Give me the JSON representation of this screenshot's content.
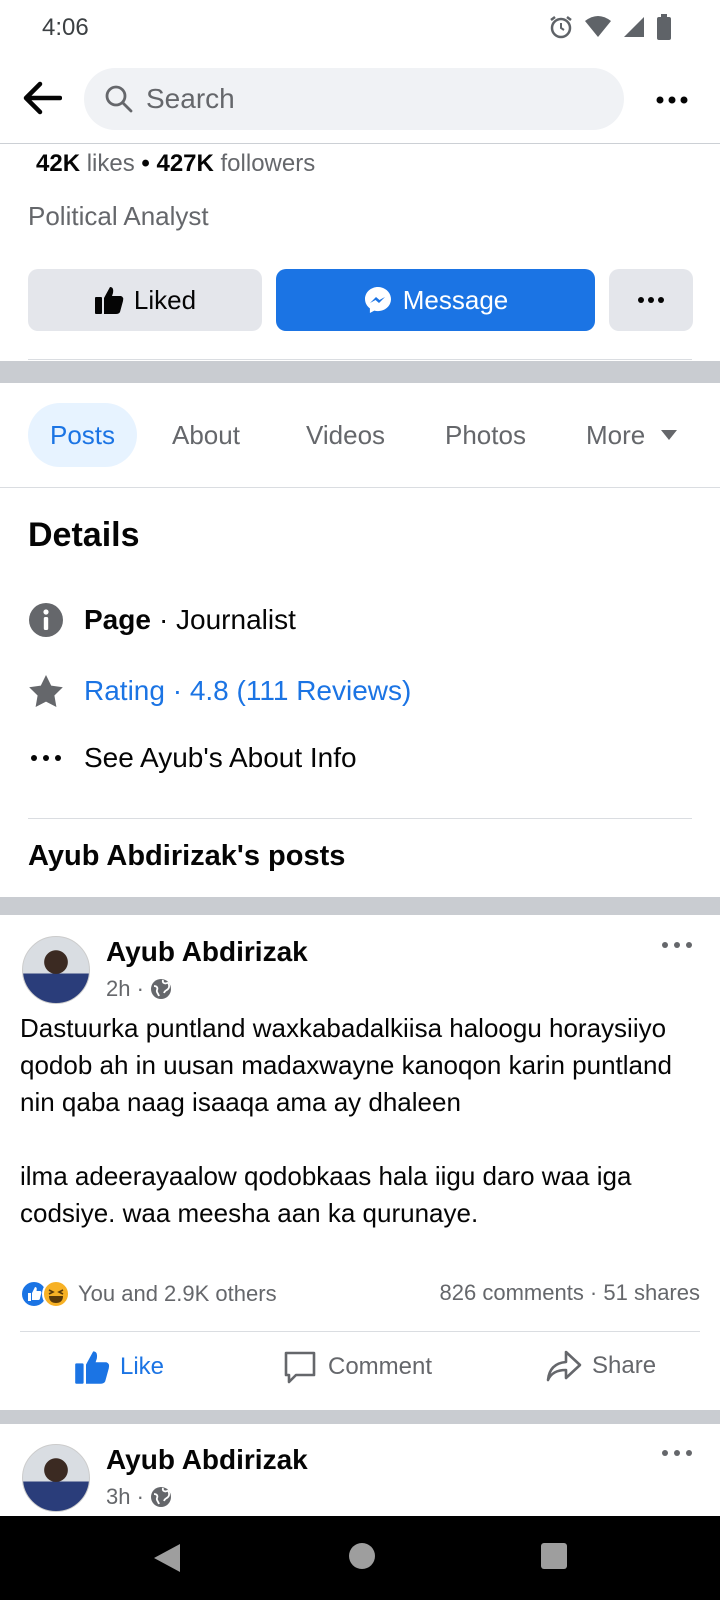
{
  "status_bar": {
    "time": "4:06"
  },
  "top_bar": {
    "search_placeholder": "Search"
  },
  "page_stats": {
    "likes_count": "42K",
    "likes_label": "likes",
    "separator": "•",
    "followers_count": "427K",
    "followers_label": "followers"
  },
  "category": "Political Analyst",
  "actions": {
    "liked_label": "Liked",
    "message_label": "Message"
  },
  "tabs": [
    {
      "label": "Posts",
      "active": true
    },
    {
      "label": "About"
    },
    {
      "label": "Videos"
    },
    {
      "label": "Photos"
    },
    {
      "label": "More"
    }
  ],
  "details": {
    "heading": "Details",
    "page_type_label": "Page",
    "page_type_value": "· Journalist",
    "rating": "Rating · 4.8 (111 Reviews)",
    "about_link": "See Ayub's About Info"
  },
  "posts_heading": "Ayub Abdirizak's posts",
  "posts": [
    {
      "author": "Ayub Abdirizak",
      "time": "2h ·",
      "paragraphs": [
        "Dastuurka puntland waxkabadalkiisa haloogu horaysiiyo qodob ah in uusan madaxwayne kanoqon karin puntland nin qaba naag isaaqa ama ay dhaleen",
        "ilma adeerayaalow qodobkaas hala iigu daro waa iga codsiye. waa meesha aan ka qurunaye."
      ],
      "reactions_text": "You and 2.9K others",
      "counts_text": "826 comments · 51 shares",
      "like_label": "Like",
      "comment_label": "Comment",
      "share_label": "Share"
    },
    {
      "author": "Ayub Abdirizak",
      "time": "3h ·"
    }
  ],
  "colors": {
    "accent": "#1b74e4",
    "secondary_text": "#65676b",
    "button_gray": "#e4e6eb"
  }
}
